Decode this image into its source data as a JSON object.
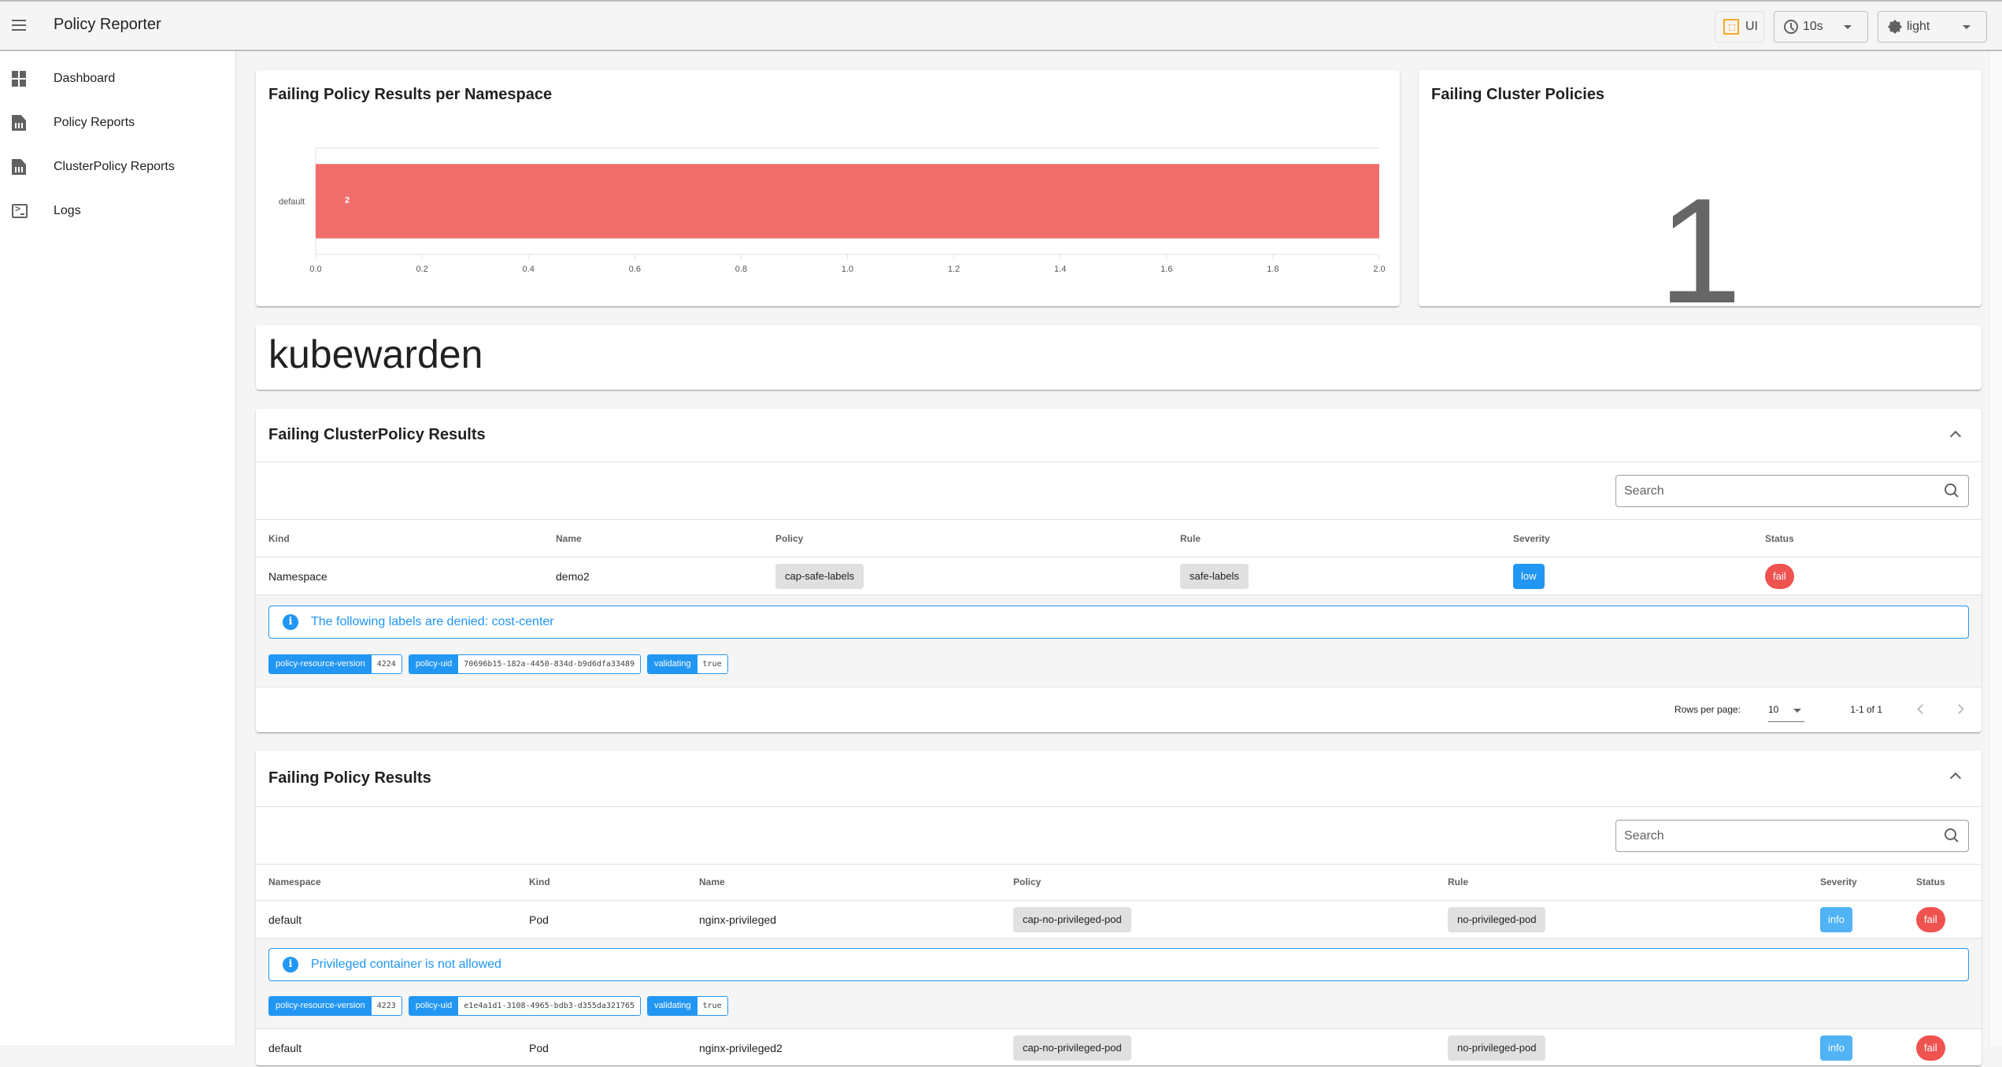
{
  "app": {
    "title": "Policy Reporter",
    "ui_button": "UI",
    "interval": "10s",
    "theme": "light"
  },
  "sidebar": {
    "items": [
      {
        "label": "Dashboard",
        "icon": "dashboard-icon"
      },
      {
        "label": "Policy Reports",
        "icon": "report-icon"
      },
      {
        "label": "ClusterPolicy Reports",
        "icon": "report-icon"
      },
      {
        "label": "Logs",
        "icon": "terminal-icon"
      }
    ]
  },
  "chart_data": {
    "type": "bar",
    "orientation": "horizontal",
    "title": "Failing Policy Results per Namespace",
    "categories": [
      "default"
    ],
    "values": [
      2
    ],
    "data_labels": [
      "2"
    ],
    "xlim": [
      0,
      2.0
    ],
    "xticks": [
      "0.0",
      "0.2",
      "0.4",
      "0.6",
      "0.8",
      "1.0",
      "1.2",
      "1.4",
      "1.6",
      "1.8",
      "2.0"
    ],
    "xlabel": "",
    "ylabel": "",
    "bar_color": "#f06e6b",
    "grid": false
  },
  "cluster_summary": {
    "title": "Failing Cluster Policies",
    "value": "1"
  },
  "engine": {
    "title": "kubewarden"
  },
  "cluster_results": {
    "title": "Failing ClusterPolicy Results",
    "search_placeholder": "Search",
    "columns": [
      "Kind",
      "Name",
      "Policy",
      "Rule",
      "Severity",
      "Status"
    ],
    "rows": [
      {
        "kind": "Namespace",
        "name": "demo2",
        "policy": "cap-safe-labels",
        "rule": "safe-labels",
        "severity": "low",
        "status": "fail",
        "message": "The following labels are denied: cost-center",
        "properties": [
          {
            "key": "policy-resource-version",
            "value": "4224"
          },
          {
            "key": "policy-uid",
            "value": "70696b15-182a-4450-834d-b9d6dfa33489"
          },
          {
            "key": "validating",
            "value": "true"
          }
        ]
      }
    ],
    "pagination": {
      "rows_per_page_label": "Rows per page:",
      "rows_per_page": "10",
      "range": "1-1 of 1"
    }
  },
  "policy_results": {
    "title": "Failing Policy Results",
    "search_placeholder": "Search",
    "columns": [
      "Namespace",
      "Kind",
      "Name",
      "Policy",
      "Rule",
      "Severity",
      "Status"
    ],
    "rows": [
      {
        "namespace": "default",
        "kind": "Pod",
        "name": "nginx-privileged",
        "policy": "cap-no-privileged-pod",
        "rule": "no-privileged-pod",
        "severity": "info",
        "status": "fail",
        "message": "Privileged container is not allowed",
        "properties": [
          {
            "key": "policy-resource-version",
            "value": "4223"
          },
          {
            "key": "policy-uid",
            "value": "e1e4a1d1-3108-4965-bdb3-d355da321765"
          },
          {
            "key": "validating",
            "value": "true"
          }
        ]
      },
      {
        "namespace": "default",
        "kind": "Pod",
        "name": "nginx-privileged2",
        "policy": "cap-no-privileged-pod",
        "rule": "no-privileged-pod",
        "severity": "info",
        "status": "fail"
      }
    ]
  },
  "colors": {
    "accent": "#2196f3",
    "severity_low": "#2196f3",
    "severity_info": "#4fb3f6",
    "status_fail": "#ef5350",
    "bar": "#f06e6b"
  }
}
